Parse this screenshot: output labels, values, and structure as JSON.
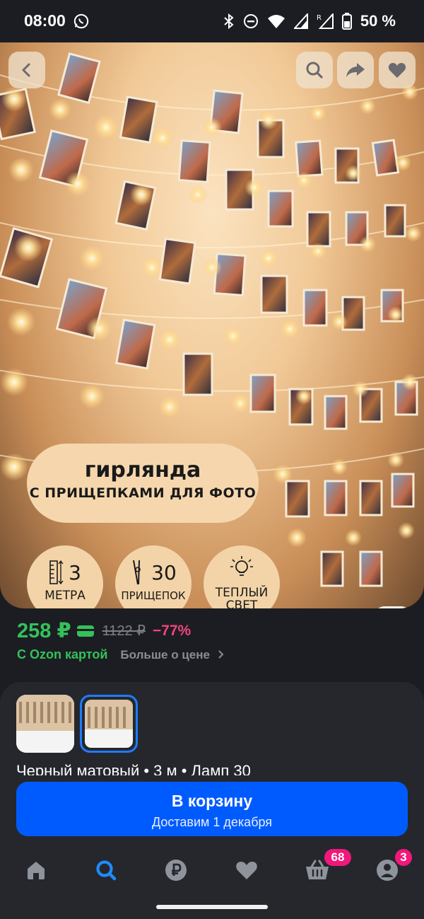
{
  "status_bar": {
    "time": "08:00",
    "battery": "50 %",
    "icons": [
      "whatsapp-icon",
      "bluetooth-icon",
      "dnd-icon",
      "wifi-icon",
      "signal-icon",
      "signal-roaming-icon",
      "battery-icon"
    ]
  },
  "hero": {
    "banner_title": "гирлянда",
    "banner_subtitle": "С ПРИЩЕПКАМИ ДЛЯ ФОТО",
    "features": [
      {
        "value": "3",
        "label": "МЕТРА",
        "icon": "ruler-icon"
      },
      {
        "value": "30",
        "label": "ПРИЩЕПОК",
        "icon": "clothespin-icon"
      },
      {
        "value": "",
        "label": "ТЕПЛЫЙ СВЕТ",
        "icon": "lightbulb-icon"
      }
    ],
    "buttons": [
      "back-icon",
      "search-icon",
      "share-icon",
      "heart-icon",
      "image-search-icon"
    ]
  },
  "price": {
    "current": "258 ₽",
    "old": "1122 ₽",
    "discount": "−77%",
    "with_card": "С Ozon картой",
    "more_link": "Больше о цене"
  },
  "variant": {
    "text": "Черный матовый • 3 м • Ламп 30"
  },
  "cart_button": {
    "title": "В корзину",
    "subtitle": "Доставим 1 декабря"
  },
  "bottom_nav": {
    "items": [
      "home-icon",
      "search-icon",
      "ruble-icon",
      "heart-icon",
      "basket-icon",
      "profile-icon"
    ],
    "active": "search-icon",
    "cart_badge": "68",
    "profile_badge": "3"
  },
  "colors": {
    "background": "#1b1d22",
    "card": "#25272d",
    "primary": "#005bff",
    "price_green": "#34c15b",
    "discount_pink": "#f2447a",
    "badge": "#f1177b"
  }
}
